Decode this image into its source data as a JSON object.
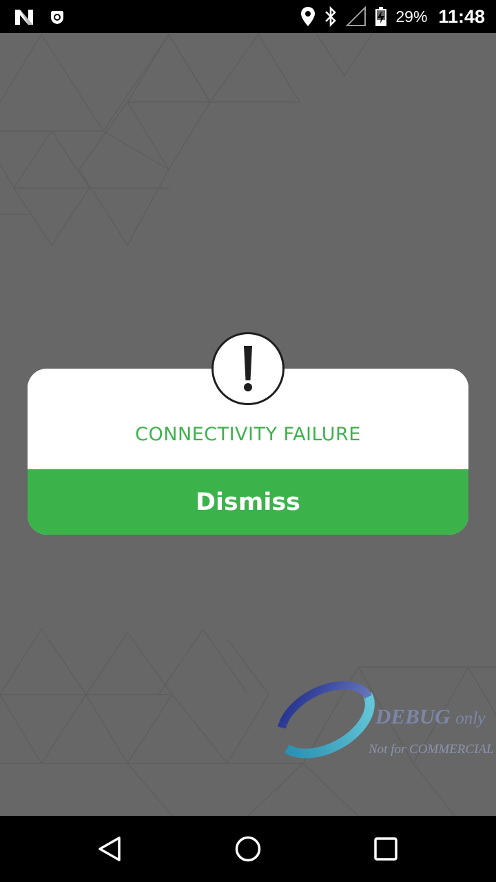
{
  "status_bar": {
    "notification_icons": [
      "n-app-icon",
      "shield-app-icon"
    ],
    "system_icons": [
      "location-icon",
      "bluetooth-icon",
      "no-signal-icon",
      "battery-charging-icon"
    ],
    "battery_percent": "29%",
    "time": "11:48"
  },
  "dialog": {
    "icon": "exclamation-icon",
    "title": "CONNECTIVITY FAILURE",
    "dismiss_label": "Dismiss"
  },
  "watermark": {
    "main": "DEBUG",
    "suffix": "only",
    "note": "Not for COMMERCIAL"
  },
  "nav_bar": {
    "buttons": [
      "back-button",
      "home-button",
      "recents-button"
    ]
  },
  "colors": {
    "background": "#676767",
    "accent_green": "#3bb34a",
    "dialog_bg": "#ffffff",
    "bars": "#000000"
  }
}
